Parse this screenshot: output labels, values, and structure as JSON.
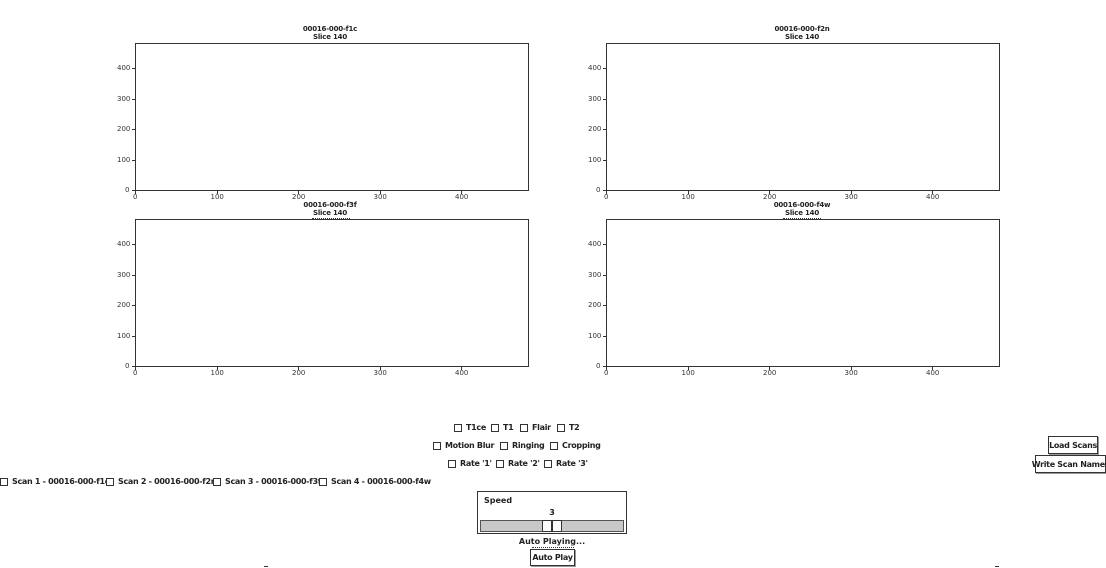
{
  "plots": [
    {
      "id": "top-left",
      "title": "00016-000-f1c",
      "subtitle": "Slice 140"
    },
    {
      "id": "top-right",
      "title": "00016-000-f2n",
      "subtitle": "Slice 140"
    },
    {
      "id": "bottom-left",
      "title": "00016-000-f3f",
      "subtitle": "Slice 140"
    },
    {
      "id": "bottom-right",
      "title": "00016-000-f4w",
      "subtitle": "Slice 140"
    }
  ],
  "axes": {
    "xticks": [
      "0",
      "100",
      "200",
      "300",
      "400"
    ],
    "yticks": [
      "0",
      "100",
      "200",
      "300",
      "400"
    ]
  },
  "options": {
    "row1": [
      "T1ce",
      "T1",
      "Flair",
      "T2"
    ],
    "row2": [
      "Motion Blur",
      "Ringing",
      "Cropping"
    ],
    "row3": [
      "Rate '1'",
      "Rate '2'",
      "Rate '3'"
    ]
  },
  "scans": [
    "Scan 1 - 00016-000-f1c",
    "Scan 2 - 00016-000-f2n",
    "Scan 3 - 00016-000-f3f",
    "Scan 4 - 00016-000-f4w"
  ],
  "buttons": {
    "load_scans": "Load Scans",
    "write_scan_names": "Write Scan Names",
    "auto_play": "Auto Play"
  },
  "speed": {
    "label": "Speed",
    "value": "3",
    "level": 0.5
  },
  "status_text": "Auto Playing..."
}
